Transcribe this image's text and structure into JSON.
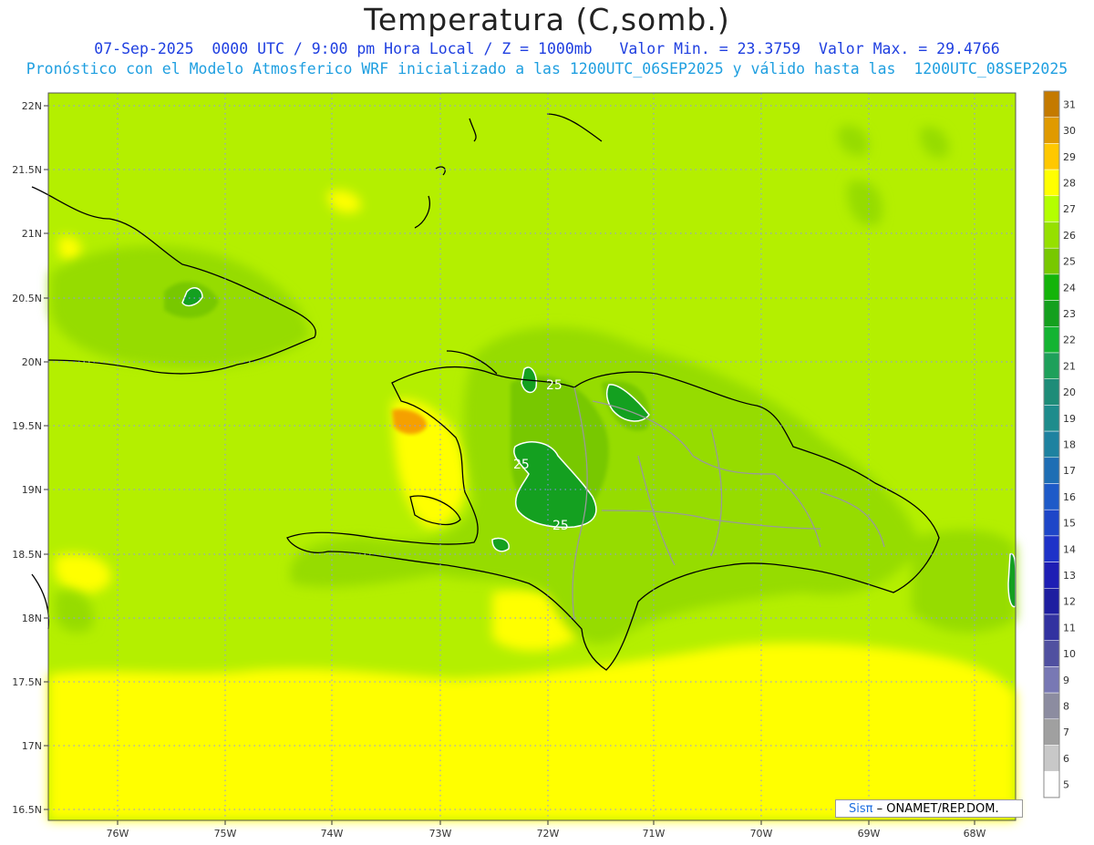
{
  "title": "Temperatura (C,somb.)",
  "subtitle_line1": "07-Sep-2025  0000 UTC / 9:00 pm Hora Local / Z = 1000mb   Valor Min. = 23.3759  Valor Max. = 29.4766",
  "subtitle_line2": "Pronóstico con el Modelo Atmosferico WRF inicializado a las 1200UTC_06SEP2025 y válido hasta las  1200UTC_08SEP2025",
  "credit_sis": "Sisπ",
  "credit_rest": " – ONAMET/REP.DOM.",
  "lat_labels": [
    "22N",
    "21.5N",
    "21N",
    "20.5N",
    "20N",
    "19.5N",
    "19N",
    "18.5N",
    "18N",
    "17.5N",
    "17N",
    "16.5N"
  ],
  "lon_labels": [
    "76W",
    "75W",
    "74W",
    "73W",
    "72W",
    "71W",
    "70W",
    "69W",
    "68W"
  ],
  "colorbar_labels": [
    "31",
    "30",
    "29",
    "28",
    "27",
    "26",
    "25",
    "24",
    "23",
    "22",
    "21",
    "20",
    "19",
    "18",
    "17",
    "16",
    "15",
    "14",
    "13",
    "12",
    "11",
    "10",
    "9",
    "8",
    "7",
    "6",
    "5"
  ],
  "colorbar_colors": [
    "#c47a00",
    "#e09a00",
    "#ffc800",
    "#ffff00",
    "#b4ff00",
    "#96e000",
    "#78c800",
    "#14b40a",
    "#14a01e",
    "#14b432",
    "#1ea05a",
    "#1e8c78",
    "#1e8c8c",
    "#1e82a0",
    "#1e6eb4",
    "#1e5ac8",
    "#1e46c8",
    "#1e32c8",
    "#1e1eb4",
    "#1e1ea0",
    "#3232a0",
    "#5050a0",
    "#7878b4",
    "#8c8ca0",
    "#a0a0a0",
    "#c8c8c8",
    "#ffffff"
  ],
  "contour_labels": [
    "25",
    "25",
    "25"
  ]
}
